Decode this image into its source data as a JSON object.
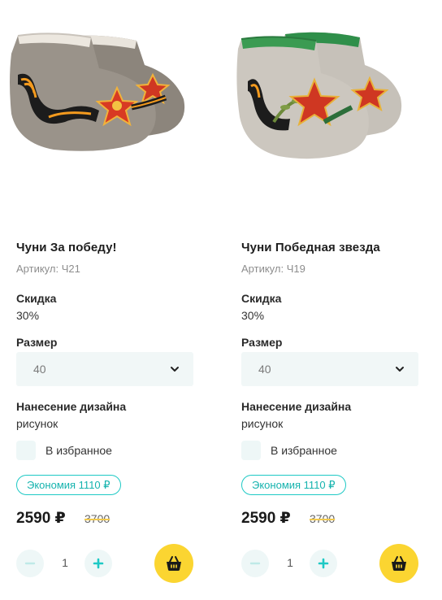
{
  "products": [
    {
      "image_alt": "Чуни За победу!",
      "title": "Чуни За победу!",
      "sku_label": "Артикул:",
      "sku": "Ч21",
      "discount_label": "Скидка",
      "discount": "30%",
      "size_label": "Размер",
      "size_selected": "40",
      "design_label": "Нанесение дизайна",
      "design": "рисунок",
      "favorite_label": "В избранное",
      "savings": "Экономия 1110 ₽",
      "price": "2590 ₽",
      "old_price": "3700",
      "quantity": "1"
    },
    {
      "image_alt": "Чуни Победная звезда",
      "title": "Чуни Победная звезда",
      "sku_label": "Артикул:",
      "sku": "Ч19",
      "discount_label": "Скидка",
      "discount": "30%",
      "size_label": "Размер",
      "size_selected": "40",
      "design_label": "Нанесение дизайна",
      "design": "рисунок",
      "favorite_label": "В избранное",
      "savings": "Экономия 1110 ₽",
      "price": "2590 ₽",
      "old_price": "3700",
      "quantity": "1"
    }
  ],
  "icons": {
    "chevron": "chevron-down-icon",
    "minus": "minus-icon",
    "plus": "plus-icon",
    "cart": "basket-icon"
  },
  "colors": {
    "accent_teal": "#1ec9c5",
    "accent_yellow": "#fbd531",
    "field_bg": "#f1f7f7",
    "strike": "#f2c94c"
  }
}
